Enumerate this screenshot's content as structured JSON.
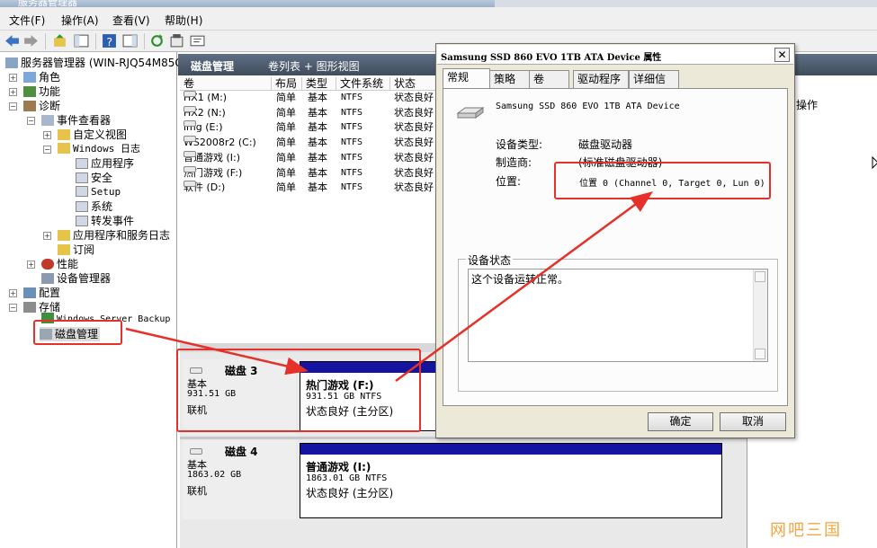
{
  "window": {
    "title": "服务器管理器"
  },
  "menu": [
    "文件(F)",
    "操作(A)",
    "查看(V)",
    "帮助(H)"
  ],
  "tree": {
    "root": "服务器管理器 (WIN-RJQ54M85GL",
    "roles": "角色",
    "features": "功能",
    "diagnostics": "诊断",
    "event_viewer": "事件查看器",
    "custom_views": "自定义视图",
    "windows_logs": "Windows 日志",
    "application": "应用程序",
    "security": "安全",
    "setup": "Setup",
    "system": "系统",
    "forwarded": "转发事件",
    "app_service_logs": "应用程序和服务日志",
    "subscriptions": "订阅",
    "performance": "性能",
    "device_manager": "设备管理器",
    "configuration": "配置",
    "storage": "存储",
    "backup": "Windows Server Backup",
    "disk_mgmt": "磁盘管理"
  },
  "middle": {
    "header_title": "磁盘管理",
    "header_view": "卷列表 + 图形视图",
    "columns": [
      "卷",
      "布局",
      "类型",
      "文件系统",
      "状态"
    ],
    "volumes": [
      {
        "name": "HX1 (M:)",
        "layout": "简单",
        "type": "基本",
        "fs": "NTFS",
        "status": "状态良好"
      },
      {
        "name": "HX2 (N:)",
        "layout": "简单",
        "type": "基本",
        "fs": "NTFS",
        "status": "状态良好"
      },
      {
        "name": "img (E:)",
        "layout": "简单",
        "type": "基本",
        "fs": "NTFS",
        "status": "状态良好"
      },
      {
        "name": "WS2008r2 (C:)",
        "layout": "简单",
        "type": "基本",
        "fs": "NTFS",
        "status": "状态良好"
      },
      {
        "name": "普通游戏 (I:)",
        "layout": "简单",
        "type": "基本",
        "fs": "NTFS",
        "status": "状态良好"
      },
      {
        "name": "热门游戏 (F:)",
        "layout": "简单",
        "type": "基本",
        "fs": "NTFS",
        "status": "状态良好"
      },
      {
        "name": "软件 (D:)",
        "layout": "简单",
        "type": "基本",
        "fs": "NTFS",
        "status": "状态良好"
      }
    ]
  },
  "disks": [
    {
      "name": "磁盘 3",
      "type": "基本",
      "size": "931.51 GB",
      "state": "联机",
      "part_name": "热门游戏  (F:)",
      "part_size": "931.51 GB NTFS",
      "part_status": "状态良好 (主分区)"
    },
    {
      "name": "磁盘 4",
      "type": "基本",
      "size": "1863.02 GB",
      "state": "联机",
      "part_name": "普通游戏  (I:)",
      "part_size": "1863.01 GB NTFS",
      "part_status": "状态良好 (主分区)"
    }
  ],
  "actions": {
    "label": "操作"
  },
  "dialog": {
    "title": "Samsung SSD 860 EVO 1TB ATA Device 属性",
    "close": "✕",
    "tabs": [
      "常规",
      "策略",
      "卷",
      "驱动程序",
      "详细信息"
    ],
    "device_name": "Samsung SSD 860 EVO 1TB ATA Device",
    "device_type_label": "设备类型:",
    "device_type_value": "磁盘驱动器",
    "manufacturer_label": "制造商:",
    "manufacturer_value": "(标准磁盘驱动器)",
    "location_label": "位置:",
    "location_value": "位置 0 (Channel 0, Target 0, Lun 0)",
    "status_group": "设备状态",
    "status_text": "这个设备运转正常。",
    "ok": "确定",
    "cancel": "取消"
  },
  "watermark": "网吧三国",
  "colors": {
    "highlight": "#e5312a",
    "partition_bar": "#1414a0",
    "header_bg": "#4b596b"
  }
}
